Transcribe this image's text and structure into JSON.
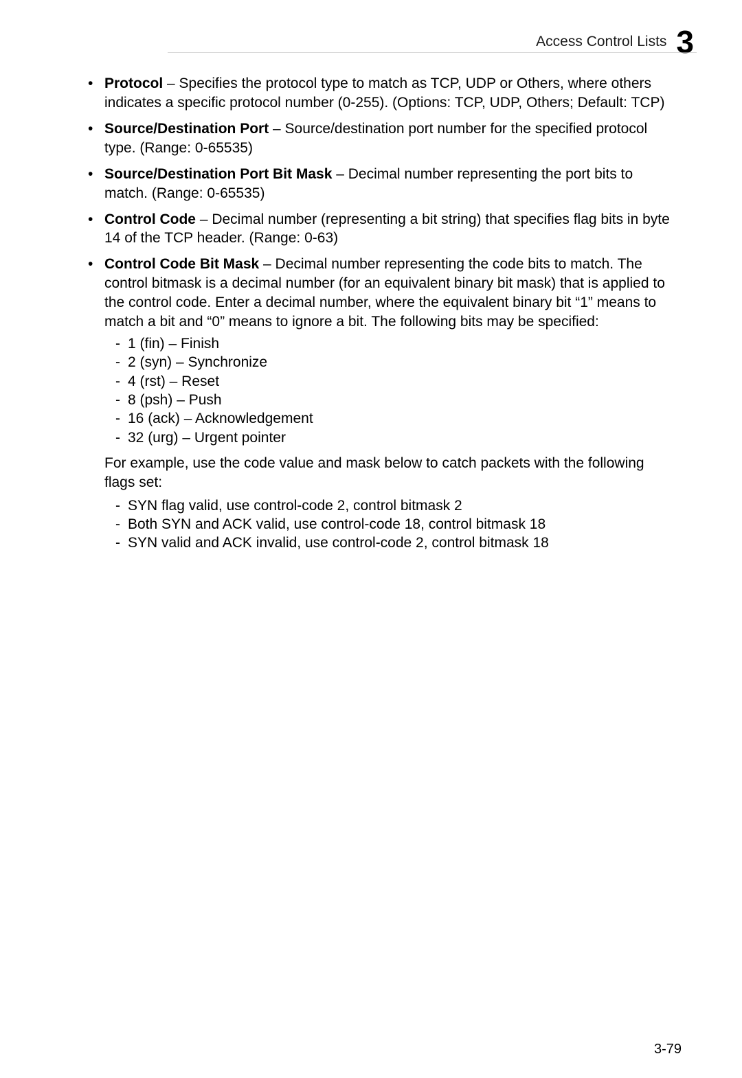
{
  "header": {
    "title": "Access Control Lists",
    "chapter": "3"
  },
  "bullets": [
    {
      "term": "Protocol",
      "desc": " – Specifies the protocol type to match as TCP, UDP or Others, where others indicates a specific protocol number (0-255). (Options: TCP, UDP, Others; Default: TCP)"
    },
    {
      "term": "Source/Destination Port",
      "desc": " – Source/destination port number for the specified protocol type. (Range: 0-65535)"
    },
    {
      "term": "Source/Destination Port Bit Mask",
      "desc": " – Decimal number representing the port bits to match. (Range: 0-65535)"
    },
    {
      "term": "Control Code",
      "desc": " – Decimal number (representing a bit string) that specifies flag bits in byte 14 of the TCP header. (Range: 0-63)"
    },
    {
      "term": "Control Code Bit Mask",
      "desc": " – Decimal number representing the code bits to match. The control bitmask is a decimal number (for an equivalent binary bit mask) that is applied to the control code. Enter a decimal number, where the equivalent binary bit “1” means to match a bit and “0” means to ignore a bit. The following bits may be specified:"
    }
  ],
  "bits": [
    " 1 (fin) – Finish",
    " 2 (syn) – Synchronize",
    " 4 (rst) – Reset",
    " 8 (psh) – Push",
    " 16 (ack) – Acknowledgement",
    " 32 (urg) – Urgent pointer"
  ],
  "example_intro": "For example, use the code value and mask below to catch packets with the following flags set:",
  "examples": [
    " SYN flag valid, use control-code 2, control bitmask 2",
    " Both SYN and ACK valid, use control-code 18, control bitmask 18",
    " SYN valid and ACK invalid, use control-code 2, control bitmask 18"
  ],
  "page_number": "3-79"
}
